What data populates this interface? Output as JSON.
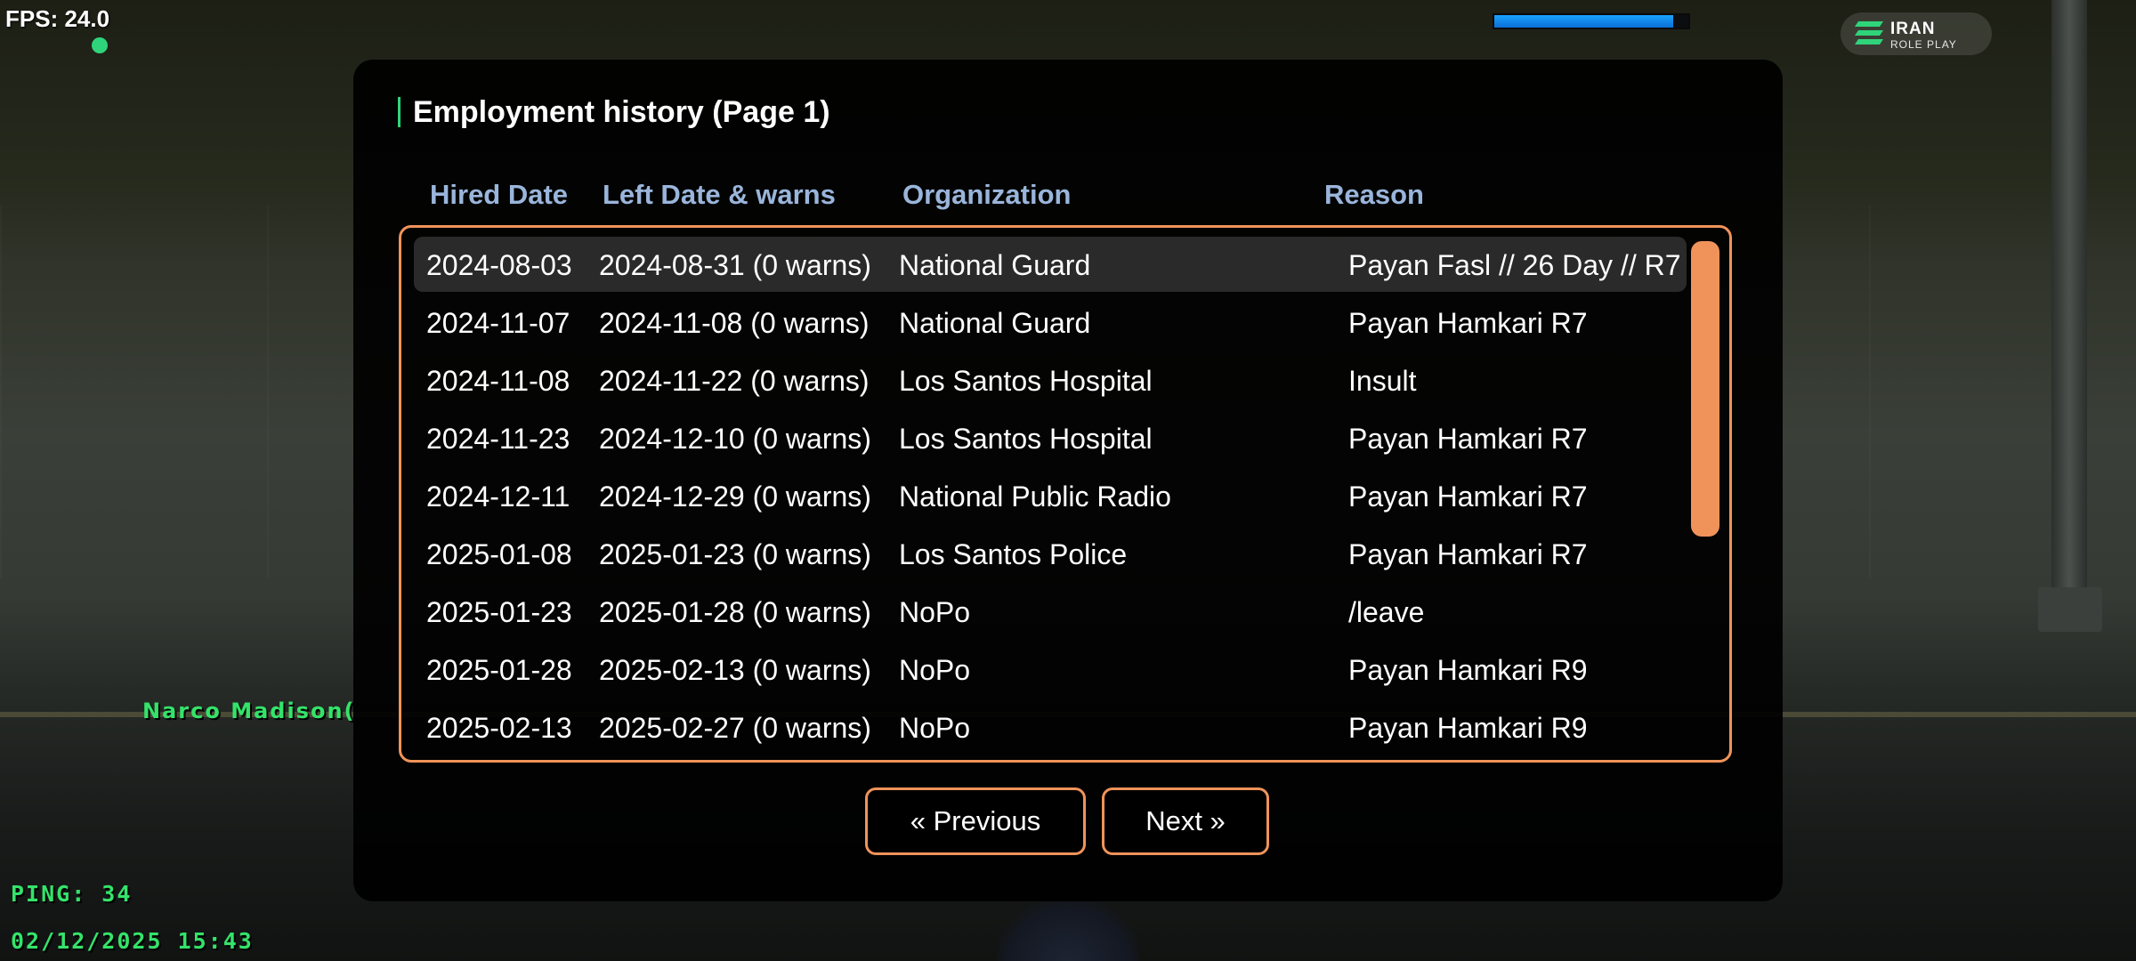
{
  "hud": {
    "fps": "FPS: 24.0",
    "ping": "PING: 34",
    "datetime": "02/12/2025 15:43",
    "nametag": "Narco Madison(",
    "health_fraction": 0.92,
    "bar_color": "#1aa3ff",
    "status_color": "#2fd47a"
  },
  "logo": {
    "title": "IRAN",
    "subtitle": "ROLE PLAY",
    "icon": "stripes-logo-icon"
  },
  "dialog": {
    "title": "Employment history (Page 1)",
    "columns": [
      "Hired Date",
      "Left Date & warns",
      "Organization",
      "Reason"
    ],
    "rows": [
      {
        "hired": "2024-08-03",
        "left": "2024-08-31 (0 warns)",
        "org": "National Guard",
        "reason": "Payan Fasl // 26 Day // R7"
      },
      {
        "hired": "2024-11-07",
        "left": "2024-11-08 (0 warns)",
        "org": "National Guard",
        "reason": "Payan Hamkari R7"
      },
      {
        "hired": "2024-11-08",
        "left": "2024-11-22 (0 warns)",
        "org": "Los Santos Hospital",
        "reason": "Insult"
      },
      {
        "hired": "2024-11-23",
        "left": "2024-12-10 (0 warns)",
        "org": "Los Santos Hospital",
        "reason": "Payan Hamkari R7"
      },
      {
        "hired": "2024-12-11",
        "left": "2024-12-29 (0 warns)",
        "org": "National Public Radio",
        "reason": "Payan Hamkari R7"
      },
      {
        "hired": "2025-01-08",
        "left": "2025-01-23 (0 warns)",
        "org": "Los Santos Police",
        "reason": "Payan Hamkari R7"
      },
      {
        "hired": "2025-01-23",
        "left": "2025-01-28 (0 warns)",
        "org": "NoPo",
        "reason": "/leave"
      },
      {
        "hired": "2025-01-28",
        "left": "2025-02-13 (0 warns)",
        "org": "NoPo",
        "reason": "Payan Hamkari R9"
      },
      {
        "hired": "2025-02-13",
        "left": "2025-02-27 (0 warns)",
        "org": "NoPo",
        "reason": "Payan Hamkari R9"
      }
    ],
    "selected_row": 0,
    "buttons": {
      "previous": "« Previous",
      "next": "Next »"
    },
    "accent_color": "#f0935a",
    "header_color": "#9ab5db"
  }
}
